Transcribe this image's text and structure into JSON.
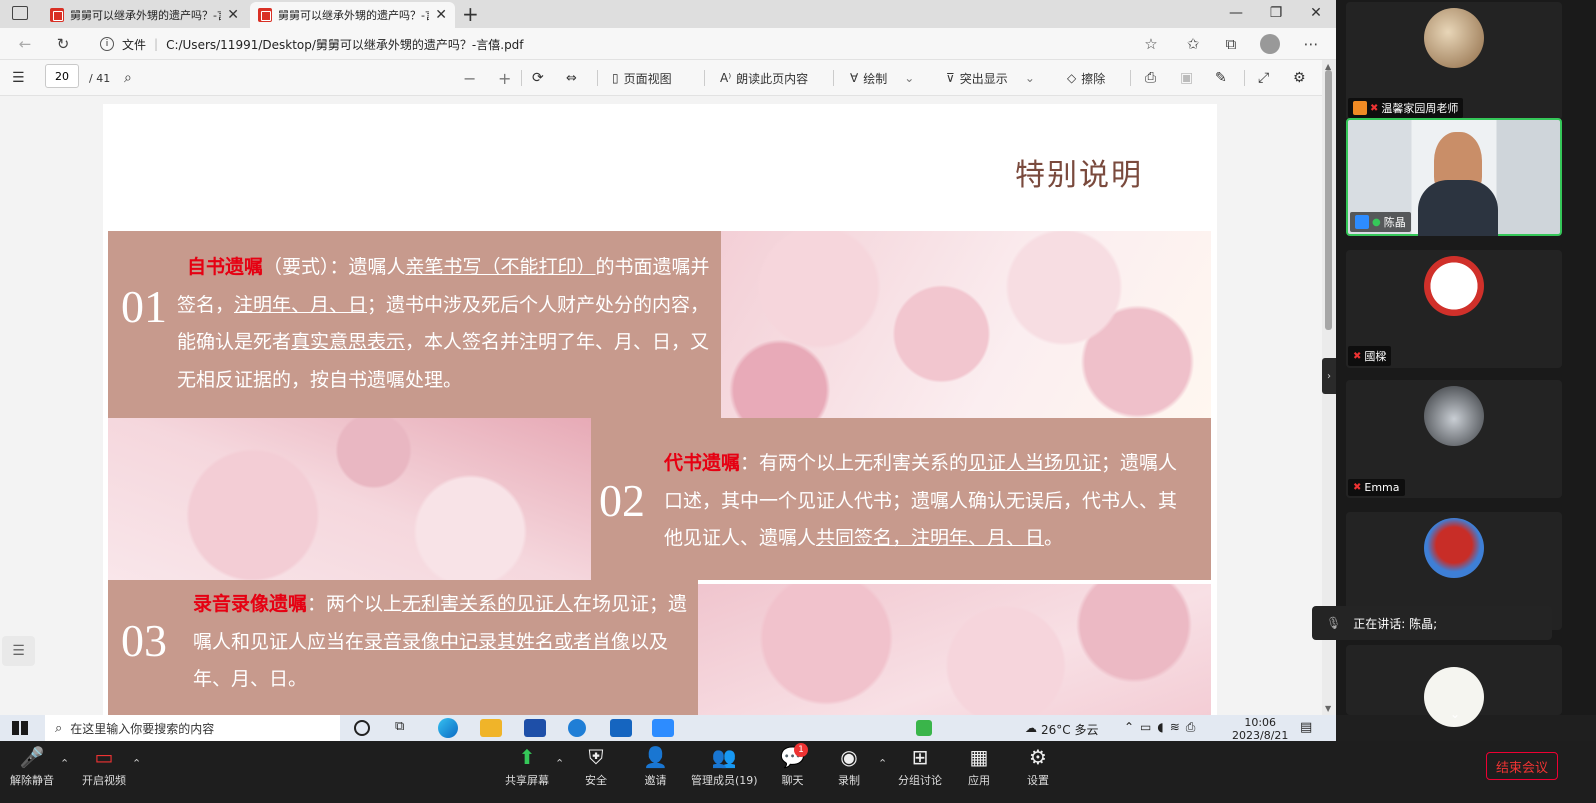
{
  "browser": {
    "tabs": [
      {
        "label": "舅舅可以继承外甥的遗产吗？-言",
        "active": false
      },
      {
        "label": "舅舅可以继承外甥的遗产吗？-言",
        "active": true
      }
    ],
    "address": {
      "info_label": "文件",
      "url": "C:/Users/11991/Desktop/舅舅可以继承外甥的遗产吗？-言僖.pdf"
    }
  },
  "pdf_toolbar": {
    "page_current": "20",
    "page_total": "/ 41",
    "page_view": "页面视图",
    "read_aloud": "朗读此页内容",
    "draw": "绘制",
    "highlight": "突出显示",
    "erase": "擦除"
  },
  "slide": {
    "title": "特别说明",
    "s1": {
      "num": "01",
      "p1": "自书遗嘱",
      "p2": "（要式）：遗嘱人",
      "p3": "亲笔书写（不能打印）",
      "p4": "的书面遗嘱并签名，",
      "p5": "注明年、月、日",
      "p6": "；遗书中涉及死后个人财产处分的内容，能确认是死者",
      "p7": "真实意思表示",
      "p8": "，本人签名并注明了年、月、日，又无相反证据的，按自书遗嘱处理。"
    },
    "s2": {
      "num": "02",
      "p1": "代书遗嘱",
      "p2": "：有两个以上无利害关系的",
      "p3": "见证人当场见证",
      "p4": "；遗嘱人口述，其中一个见证人代书；遗嘱人确认无误后，代书人、其他见证人、遗嘱人",
      "p5": "共同签名，注明年、月、日",
      "p6": "。"
    },
    "s3": {
      "num": "03",
      "p1": "录音录像遗嘱",
      "p2": "：两个以上",
      "p3": "无利害关系的见证人",
      "p4": "在场见证；遗嘱人和见证人应当在",
      "p5": "录音录像中记录其姓名或者肖像",
      "p6": "以及年、月、日。"
    }
  },
  "taskbar": {
    "search_placeholder": "在这里输入你要搜索的内容",
    "weather": "26°C 多云",
    "time": "10:06",
    "date": "2023/8/21"
  },
  "zoom": {
    "participants": [
      {
        "name": "温馨家园周老师",
        "muted": true
      },
      {
        "name": "陈晶",
        "muted": false
      },
      {
        "name": "國樑",
        "muted": true
      },
      {
        "name": "Emma",
        "muted": true
      },
      {
        "name": "",
        "muted": true
      },
      {
        "name": "",
        "muted": true
      }
    ],
    "speaking": "正在讲话: 陈晶;",
    "controls": {
      "unmute": "解除静音",
      "video": "开启视频",
      "share": "共享屏幕",
      "security": "安全",
      "invite": "邀请",
      "participants": "管理成员(19)",
      "chat": "聊天",
      "chat_badge": "1",
      "record": "录制",
      "breakout": "分组讨论",
      "apps": "应用",
      "settings": "设置",
      "end": "结束会议"
    }
  }
}
